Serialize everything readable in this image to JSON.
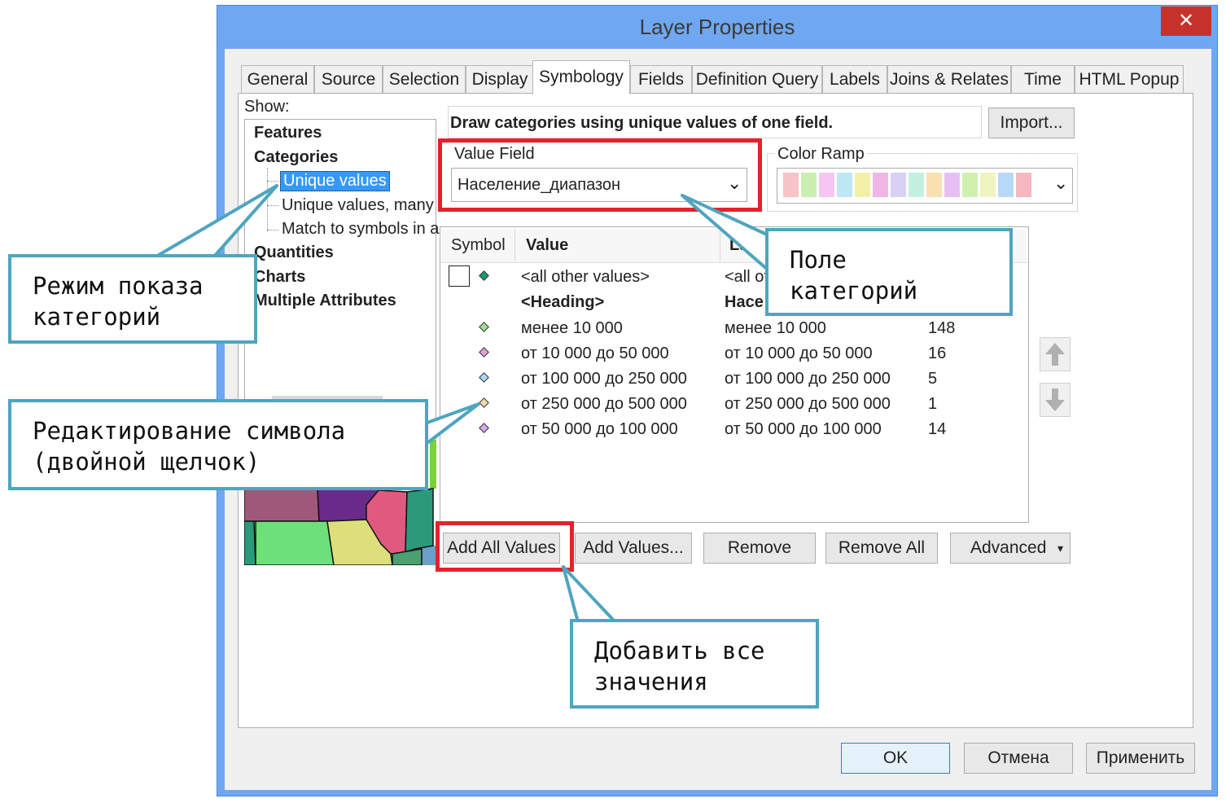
{
  "window": {
    "title": "Layer Properties",
    "close_glyph": "✕"
  },
  "tabs": [
    "General",
    "Source",
    "Selection",
    "Display",
    "Symbology",
    "Fields",
    "Definition Query",
    "Labels",
    "Joins & Relates",
    "Time",
    "HTML Popup"
  ],
  "show": {
    "label": "Show:",
    "items": [
      "Features",
      "Categories",
      "Unique values",
      "Unique values, many",
      "Match to symbols in a",
      "Quantities",
      "Charts",
      "Multiple Attributes"
    ]
  },
  "symbology": {
    "description": "Draw categories using unique values of one field.",
    "import_label": "Import...",
    "value_field_label": "Value Field",
    "value_field_value": "Население_диапазон",
    "color_ramp_label": "Color Ramp",
    "ramp_colors": [
      "#f7c3c7",
      "#c9f0b0",
      "#f6c6f0",
      "#bde7f5",
      "#f5f0a8",
      "#f0b6e6",
      "#d8d0f5",
      "#c4f0e0",
      "#f8e0b0",
      "#e6c0f5",
      "#d0f0b0",
      "#f0f5c0",
      "#b8d8f8",
      "#f5b8c0"
    ]
  },
  "table": {
    "headers": {
      "symbol": "Symbol",
      "value": "Value",
      "label": "La",
      "count": ""
    },
    "all_other": {
      "value": "<all other values>",
      "label": "<all ot"
    },
    "heading": {
      "value": "<Heading>",
      "label": "Насе"
    },
    "rows": [
      {
        "value": "менее 10 000",
        "label": "менее 10 000",
        "count": "148",
        "color": "#9fe08f"
      },
      {
        "value": "от 10 000 до 50 000",
        "label": "от 10 000 до 50 000",
        "count": "16",
        "color": "#e0a0d8"
      },
      {
        "value": "от 100 000 до 250 000",
        "label": "от 100 000 до 250 000",
        "count": "5",
        "color": "#a8d8f0"
      },
      {
        "value": "от 250 000 до 500 000",
        "label": "от 250 000 до 500 000",
        "count": "1",
        "color": "#f0d8a8"
      },
      {
        "value": "от 50 000 до 100 000",
        "label": "от 50 000 до 100 000",
        "count": "14",
        "color": "#d8a8f0"
      }
    ]
  },
  "buttons": {
    "add_all": "Add All Values",
    "add_values": "Add Values...",
    "remove": "Remove",
    "remove_all": "Remove All",
    "advanced": "Advanced",
    "ok": "OK",
    "cancel": "Отмена",
    "apply": "Применить"
  },
  "callouts": {
    "mode": "Режим показа\nкатегорий",
    "field": "Поле\nкатегорий",
    "symbol": "Редактирование символа\n(двойной щелчок)",
    "add_all": "Добавить все\nзначения"
  }
}
